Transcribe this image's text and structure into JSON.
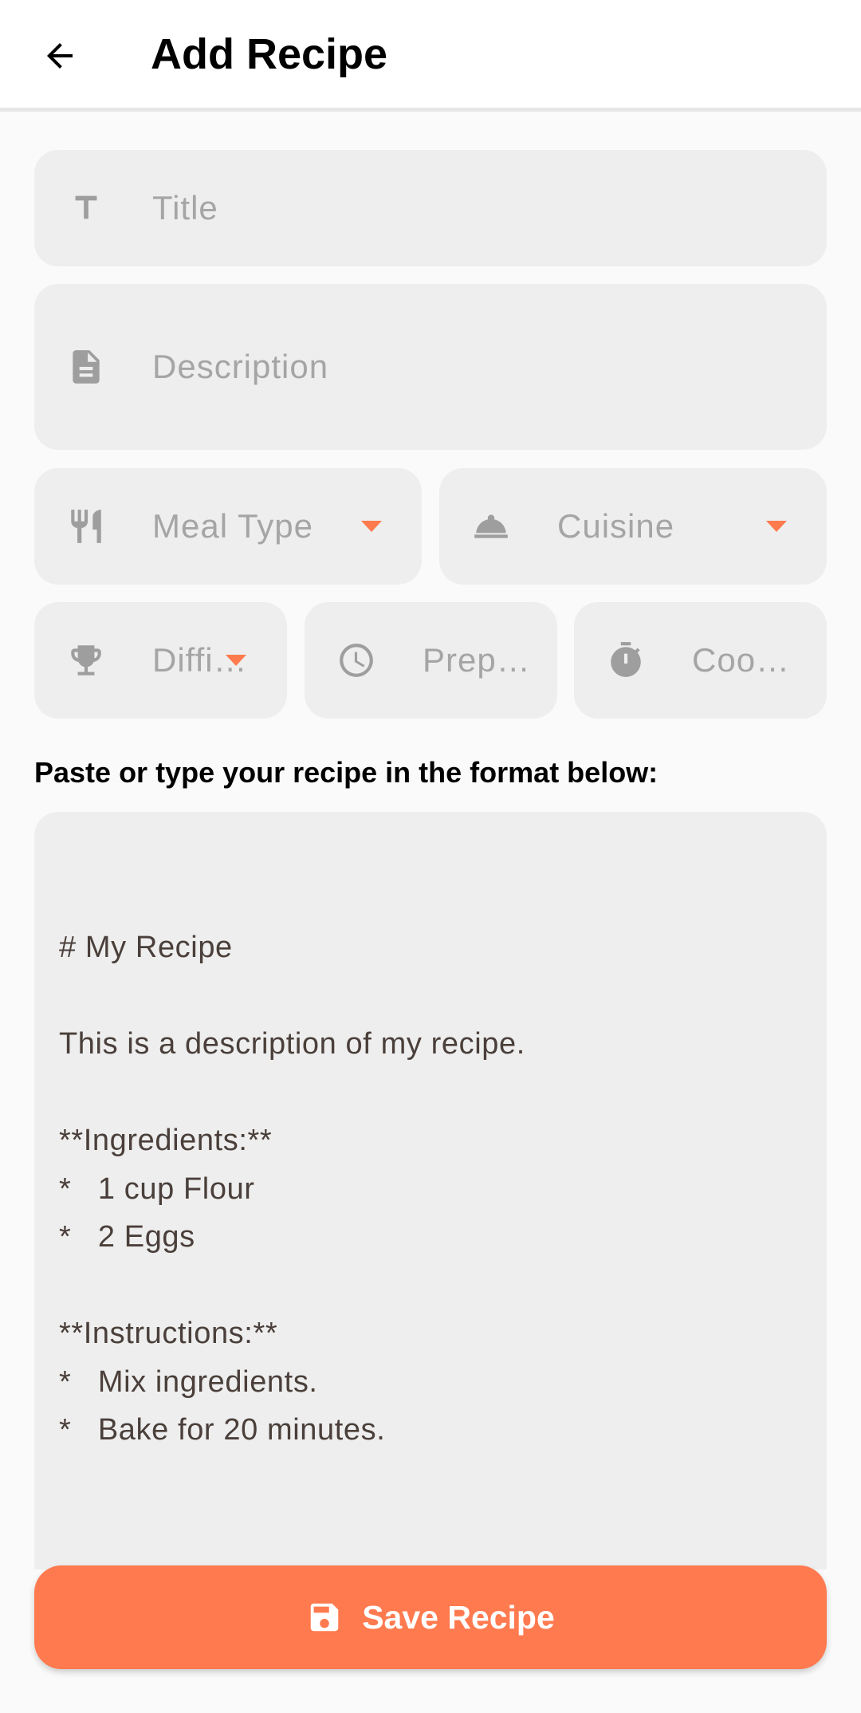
{
  "header": {
    "title": "Add Recipe",
    "back_icon": "arrow-back-icon"
  },
  "form": {
    "title_placeholder": "Title",
    "description_placeholder": "Description",
    "meal_type_placeholder": "Meal Type",
    "cuisine_placeholder": "Cuisine",
    "difficulty_placeholder": "Diffi…",
    "prep_placeholder": "Prep…",
    "cook_placeholder": "Coo…",
    "hint": "Paste or type your recipe in the format below:",
    "recipe_text": "# My Recipe\n\nThis is a description of my recipe.\n\n**Ingredients:**\n*   1 cup Flour\n*   2 Eggs\n\n**Instructions:**\n*   Mix ingredients.\n*   Bake for 20 minutes."
  },
  "actions": {
    "save_label": "Save Recipe"
  },
  "colors": {
    "accent": "#ff7a4f",
    "field_bg": "#eeeeee",
    "icon_gray": "#9e9e9e"
  }
}
